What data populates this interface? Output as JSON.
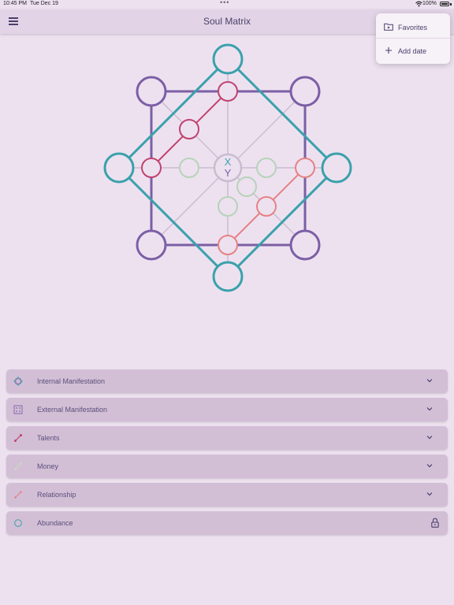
{
  "status": {
    "time": "10:45 PM",
    "date": "Tue Dec 19",
    "battery": "100%"
  },
  "nav": {
    "title": "Soul Matrix"
  },
  "menu": {
    "items": [
      {
        "label": "Favorites",
        "icon": "folder-star-icon"
      },
      {
        "label": "Add date",
        "icon": "plus-icon"
      }
    ]
  },
  "matrix": {
    "center_top": "X",
    "center_bottom": "Y",
    "colors": {
      "outer_square": "#7c5fa5",
      "outer_diamond": "#3aa1ab",
      "talents": "#c0436e",
      "money": "#b6d3b8",
      "relationship": "#e58283",
      "center": "#c7bcd0"
    }
  },
  "sections": [
    {
      "label": "Internal Manifestation",
      "icon": "internal-manifestation-icon",
      "locked": false
    },
    {
      "label": "External Manifestation",
      "icon": "external-manifestation-icon",
      "locked": false
    },
    {
      "label": "Talents",
      "icon": "talents-line-icon",
      "locked": false
    },
    {
      "label": "Money",
      "icon": "money-line-icon",
      "locked": false
    },
    {
      "label": "Relationship",
      "icon": "relationship-line-icon",
      "locked": false
    },
    {
      "label": "Abundance",
      "icon": "abundance-circle-icon",
      "locked": true
    }
  ]
}
